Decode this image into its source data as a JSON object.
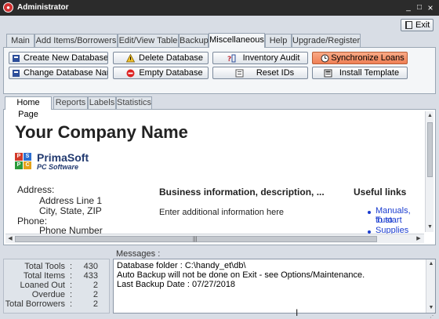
{
  "window": {
    "title": "Administrator",
    "minimize_glyph": "_",
    "maximize_glyph": "□",
    "close_glyph": "×"
  },
  "exit_button": {
    "label": "Exit",
    "icon": "exit-door-icon"
  },
  "main_tabs": [
    {
      "label": "Main"
    },
    {
      "label": "Add Items/Borrowers"
    },
    {
      "label": "Edit/View Table"
    },
    {
      "label": "Backup"
    },
    {
      "label": "Miscellaneous",
      "active": true
    },
    {
      "label": "Help"
    },
    {
      "label": "Upgrade/Register"
    }
  ],
  "ribbon": {
    "create_db": {
      "label": "Create New Database",
      "icon": "database-icon"
    },
    "change_db": {
      "label": "Change Database Name",
      "icon": "database-icon"
    },
    "delete_db": {
      "label": "Delete Database",
      "icon": "warning-icon"
    },
    "empty_db": {
      "label": "Empty Database",
      "icon": "no-entry-icon"
    },
    "inventory_audit": {
      "label": "Inventory Audit",
      "icon": "audit-icon"
    },
    "reset_ids": {
      "label": "Reset IDs",
      "icon": "reset-icon"
    },
    "sync_loans": {
      "label": "Synchronize Loans",
      "icon": "clock-icon",
      "color": "#ef7f55"
    },
    "install_template": {
      "label": "Install Template",
      "icon": "template-icon"
    }
  },
  "sub_tabs": [
    {
      "label": "Home Page",
      "active": true
    },
    {
      "label": "Reports"
    },
    {
      "label": "Labels"
    },
    {
      "label": "Statistics"
    }
  ],
  "home_page": {
    "company_name": "Your Company Name",
    "logo": {
      "brand": "PrimaSoft",
      "sub": "PC Software",
      "letters": [
        "P",
        "S",
        "P",
        "C"
      ]
    },
    "address_label": "Address:",
    "address_lines": [
      "Address Line 1",
      "City, State, ZIP"
    ],
    "phone_label": "Phone:",
    "phone_value": "Phone Number",
    "business_heading": "Business information, description, ...",
    "business_text": "Enter additional information here",
    "links_heading": "Useful links",
    "links": [
      "Manuals, Tuto",
      "to start",
      "Supplies"
    ]
  },
  "stats": [
    {
      "label": "Total Tools",
      "value": "430"
    },
    {
      "label": "Total Items",
      "value": "433"
    },
    {
      "label": "Loaned Out",
      "value": "2"
    },
    {
      "label": "Overdue",
      "value": "2"
    },
    {
      "label": "Total Borrowers",
      "value": "2"
    }
  ],
  "messages": {
    "label": "Messages :",
    "lines": [
      "Database folder : C:\\handy_et\\db\\",
      "Auto Backup will not be done on Exit - see Options/Maintenance.",
      "Last Backup Date : 07/27/2018"
    ]
  }
}
